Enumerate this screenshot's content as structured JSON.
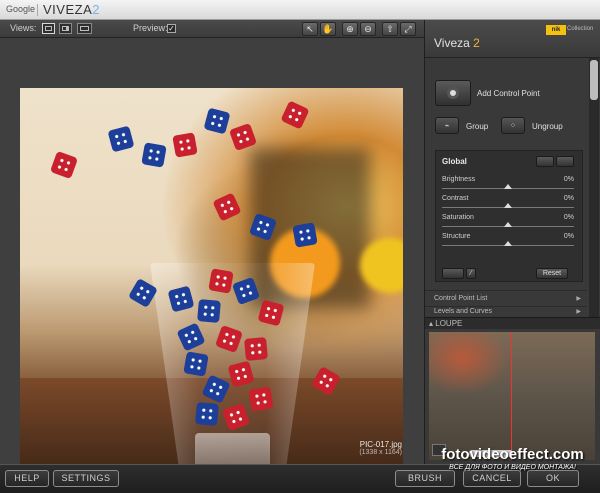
{
  "window": {
    "brand": "Google",
    "app_name": "VIVEZA",
    "app_version": "2"
  },
  "toolbar": {
    "views_label": "Views:",
    "preview_label": "Preview:",
    "preview_checked": true,
    "tools": [
      "hand-select-icon",
      "pan-hand-icon",
      "zoom-in-icon",
      "zoom-out-icon",
      "rotate-icon",
      "fit-icon"
    ]
  },
  "image": {
    "filename": "PIC-017.jpg",
    "dimensions": "(1338 x 1164)"
  },
  "panel": {
    "title": "Viveza",
    "title_version": "2",
    "nik_badge": "nik",
    "collection_label": "Collection",
    "add_control_point": "Add Control Point",
    "group_label": "Group",
    "ungroup_label": "Ungroup",
    "global_title": "Global",
    "sliders": [
      {
        "label": "Brightness",
        "value": "0%",
        "position": 0.5
      },
      {
        "label": "Contrast",
        "value": "0%",
        "position": 0.5
      },
      {
        "label": "Saturation",
        "value": "0%",
        "position": 0.5
      },
      {
        "label": "Structure",
        "value": "0%",
        "position": 0.5
      }
    ],
    "reset_label": "Reset",
    "control_point_list": "Control Point List",
    "levels_curves": "Levels and Curves",
    "loupe_label": "LOUPE"
  },
  "bottom": {
    "help": "HELP",
    "settings": "SETTINGS",
    "brush": "BRUSH",
    "cancel": "CANCEL",
    "ok": "OK"
  },
  "watermark": {
    "line1": "fotovideoeffect.com",
    "line2": "ВСЕ ДЛЯ ФОТО И ВИДЕО МОНТАЖА!"
  },
  "colors": {
    "accent_orange": "#f2b23a",
    "version_blue": "#7bb3e8",
    "loupe_line": "#ee3333"
  }
}
